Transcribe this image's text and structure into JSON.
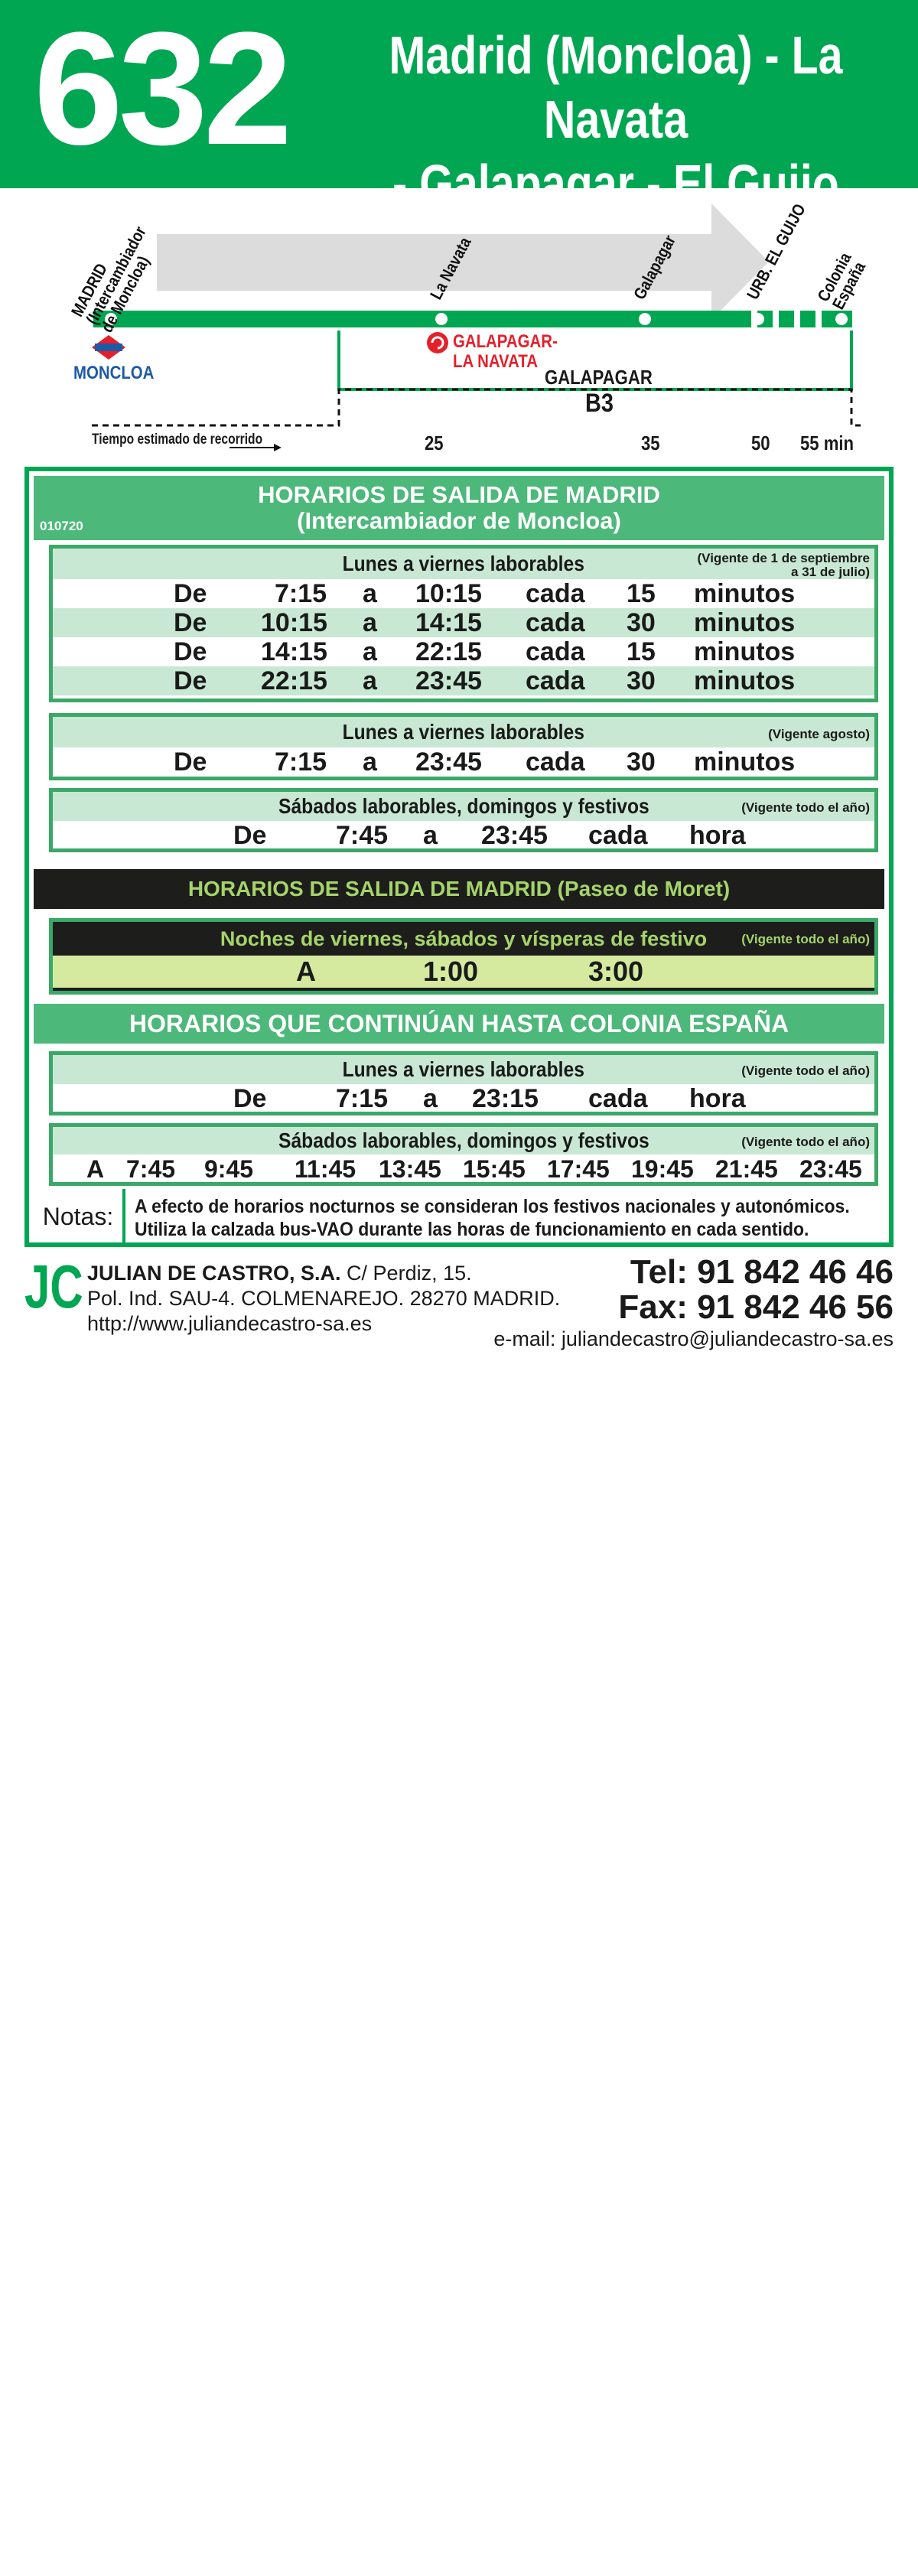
{
  "header": {
    "route_number": "632",
    "route_line1": "Madrid (Moncloa) - La Navata",
    "route_line2": "- Galapagar - El Guijo"
  },
  "map": {
    "stops": {
      "madrid_1": "MADRID",
      "madrid_2": "(Intercambiador",
      "madrid_3": "de Moncloa)",
      "la_navata": "La Navata",
      "galapagar": "Galapagar",
      "urb_el_guijo": "URB. EL GUIJO",
      "colonia_1": "Colonia",
      "colonia_2": "España"
    },
    "metro_station": "MONCLOA",
    "zone_name_1": "GALAPAGAR-",
    "zone_name_2": "LA NAVATA",
    "municipality": "GALAPAGAR",
    "zone_code": "B3",
    "time_caption": "Tiempo estimado de recorrido",
    "times": [
      "25",
      "35",
      "50",
      "55 min"
    ]
  },
  "schedule": {
    "code": "010720",
    "moncloa_title_1": "HORARIOS DE SALIDA DE MADRID",
    "moncloa_title_2": "(Intercambiador de Moncloa)",
    "weekday_sep": {
      "title": "Lunes a viernes laborables",
      "validity_1": "(Vigente de 1 de septiembre",
      "validity_2": "a 31 de julio)",
      "rows": [
        [
          "De",
          "7:15",
          "a",
          "10:15",
          "cada",
          "15",
          "minutos"
        ],
        [
          "De",
          "10:15",
          "a",
          "14:15",
          "cada",
          "30",
          "minutos"
        ],
        [
          "De",
          "14:15",
          "a",
          "22:15",
          "cada",
          "15",
          "minutos"
        ],
        [
          "De",
          "22:15",
          "a",
          "23:45",
          "cada",
          "30",
          "minutos"
        ]
      ]
    },
    "weekday_aug": {
      "title": "Lunes a viernes laborables",
      "validity": "(Vigente agosto)",
      "row": [
        "De",
        "7:15",
        "a",
        "23:45",
        "cada",
        "30",
        "minutos"
      ]
    },
    "weekend": {
      "title": "Sábados laborables, domingos y festivos",
      "validity": "(Vigente todo el año)",
      "row": [
        "De",
        "7:45",
        "a",
        "23:45",
        "cada",
        "hora"
      ]
    },
    "moret_title": "HORARIOS DE SALIDA DE MADRID (Paseo de Moret)",
    "night": {
      "title": "Noches de viernes, sábados y vísperas de festivo",
      "validity": "(Vigente todo el año)",
      "row": [
        "A",
        "1:00",
        "3:00"
      ]
    },
    "colonia_title": "HORARIOS QUE CONTINÚAN HASTA COLONIA ESPAÑA",
    "colonia_weekday": {
      "title": "Lunes a viernes laborables",
      "validity": "(Vigente todo el año)",
      "row": [
        "De",
        "7:15",
        "a",
        "23:15",
        "cada",
        "hora"
      ]
    },
    "colonia_weekend": {
      "title": "Sábados laborables, domingos y festivos",
      "validity": "(Vigente todo el año)",
      "row": [
        "A",
        "7:45",
        "9:45",
        "11:45",
        "13:45",
        "15:45",
        "17:45",
        "19:45",
        "21:45",
        "23:45"
      ]
    },
    "notes_label": "Notas:",
    "notes_1": "A efecto de horarios nocturnos se consideran los festivos nacionales y autonómicos.",
    "notes_2": "Utiliza la calzada bus-VAO durante las horas de funcionamiento en cada sentido."
  },
  "footer": {
    "logo": "JC",
    "company_name": "JULIAN DE CASTRO, S.A.",
    "address_1": "C/ Perdiz, 15.",
    "address_2": "Pol. Ind. SAU-4. COLMENAREJO. 28270 MADRID.",
    "web": "http://www.juliandecastro-sa.es",
    "tel": "Tel: 91 842 46 46",
    "fax": "Fax: 91 842 46 56",
    "email": "e-mail: juliandecastro@juliandecastro-sa.es"
  },
  "colors": {
    "brand_green": "#00a651",
    "light_green": "#c8e8d3",
    "night_dark": "#1d1d1b",
    "night_accent": "#a5d46a",
    "metro_red": "#e4202b",
    "metro_blue": "#1c5aa6"
  },
  "icons": {
    "metro": "metro-logo-icon",
    "renfe": "renfe-cercanias-icon"
  }
}
